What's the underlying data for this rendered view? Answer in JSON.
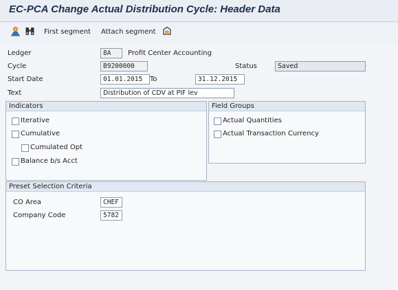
{
  "window": {
    "title": "EC-PCA Change Actual Distribution Cycle: Header Data"
  },
  "toolbar": {
    "first_segment": "First segment",
    "attach_segment": "Attach segment"
  },
  "header": {
    "ledger_label": "Ledger",
    "ledger_value": "8A",
    "ledger_text": "Profit Center Accounting",
    "cycle_label": "Cycle",
    "cycle_value": "B9200000",
    "status_label": "Status",
    "status_value": "Saved",
    "start_date_label": "Start Date",
    "start_date_value": "01.01.2015",
    "to_label": "To",
    "end_date_value": "31.12.2015",
    "text_label": "Text",
    "text_value": "Distribution of CDV at PIF lev"
  },
  "indicators": {
    "title": "Indicators",
    "iterative": "Iterative",
    "iterative_checked": false,
    "cumulative": "Cumulative",
    "cumulative_checked": false,
    "cumulated_opt": "Cumulated Opt",
    "cumulated_opt_checked": false,
    "balance": "Balance b/s Acct",
    "balance_checked": false
  },
  "field_groups": {
    "title": "Field Groups",
    "actual_quantities": "Actual Quantities",
    "actual_quantities_checked": false,
    "actual_transaction_currency": "Actual Transaction Currency",
    "actual_transaction_currency_checked": false
  },
  "preset": {
    "title": "Preset Selection Criteria",
    "co_area_label": "CO Area",
    "co_area_value": "CHEF",
    "company_code_label": "Company Code",
    "company_code_value": "5782"
  }
}
